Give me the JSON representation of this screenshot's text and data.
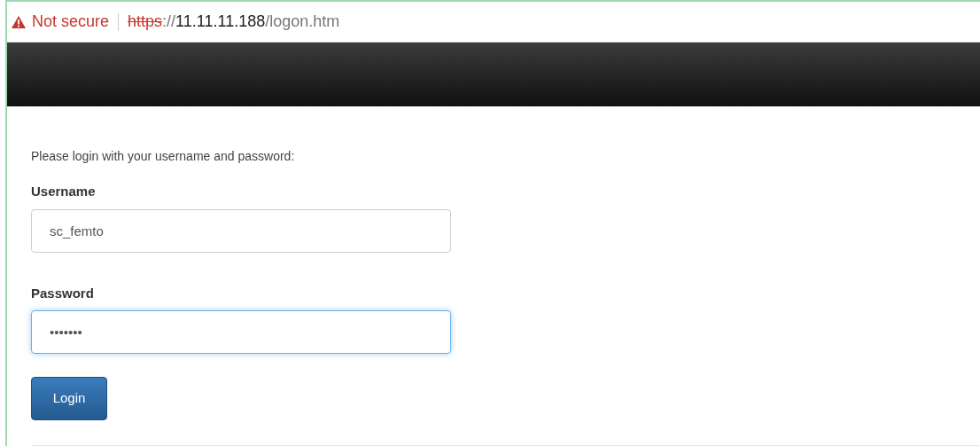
{
  "address_bar": {
    "security_label": "Not secure",
    "url_scheme": "https",
    "url_separator": "://",
    "url_host": "11.11.11.188",
    "url_path": "/logon.htm"
  },
  "login_form": {
    "intro": "Please login with your username and password:",
    "fields": [
      {
        "label": "Username",
        "value": "sc_femto",
        "focused": false
      },
      {
        "label": "Password",
        "value": "•••••••",
        "focused": true
      }
    ],
    "button": "Login"
  }
}
